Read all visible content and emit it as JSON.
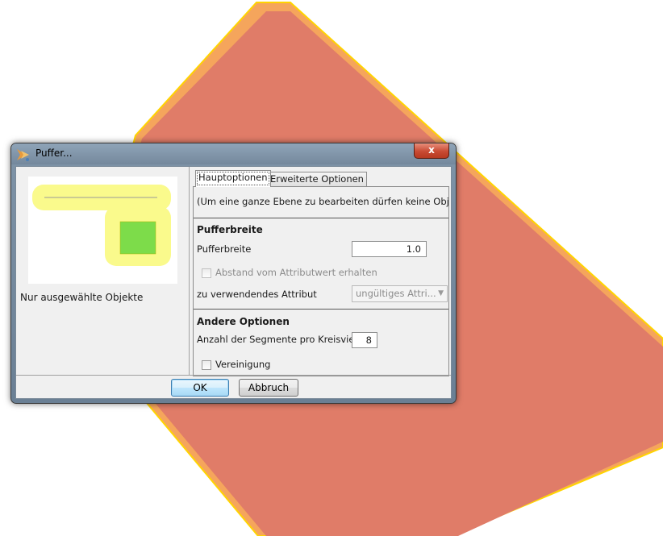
{
  "window": {
    "title": "Puffer...",
    "close_label": "x"
  },
  "left_pane": {
    "caption": "Nur ausgewählte Objekte"
  },
  "tabs": [
    {
      "label": "Hauptoptionen",
      "active": true
    },
    {
      "label": "Erweiterte Optionen",
      "active": false
    }
  ],
  "main": {
    "hint": "(Um eine ganze Ebene zu bearbeiten dürfen keine Objekte...",
    "section_buffer": {
      "heading": "Pufferbreite",
      "width_label": "Pufferbreite",
      "width_value": "1.0",
      "keep_distance_label": "Abstand vom Attributwert erhalten",
      "keep_distance_checked": false,
      "attribute_label": "zu verwendendes Attribut",
      "attribute_value": "ungültiges Attri..."
    },
    "section_other": {
      "heading": "Andere Optionen",
      "segments_label": "Anzahl der Segmente pro Kreisviertel",
      "segments_value": "8",
      "union_label": "Vereinigung",
      "union_checked": false
    }
  },
  "buttons": {
    "ok": "OK",
    "cancel": "Abbruch"
  },
  "colors": {
    "map_polygon_fill": "#e07c68",
    "map_polygon_outline": "#f5a55c",
    "map_polygon_edge": "#ffd400",
    "preview_buffer": "#fafa8c",
    "preview_square": "#7ddc4a"
  }
}
